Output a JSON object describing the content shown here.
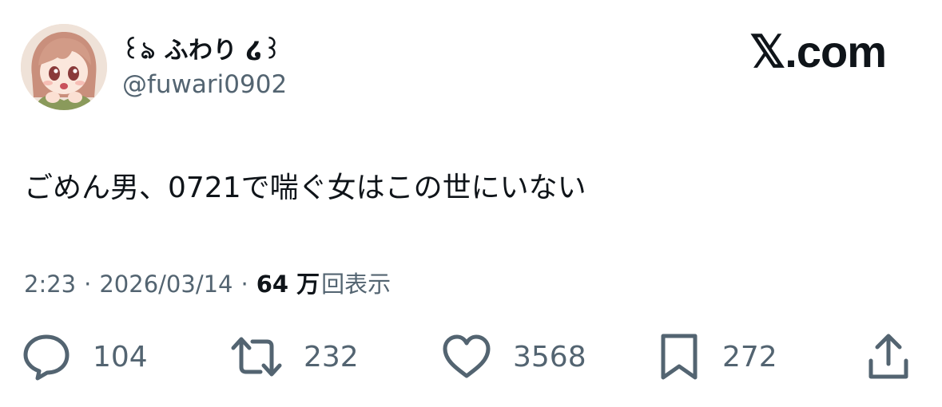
{
  "author": {
    "display_name": "꒰ঌ ふわり ໒꒱",
    "handle": "@fuwari0902",
    "avatar": "anime-girl-avatar"
  },
  "brand": {
    "label": "𝕏.com"
  },
  "tweet": {
    "text": "ごめん男、0721で喘ぐ女はこの世にいない"
  },
  "meta": {
    "time": "2:23",
    "separator": "·",
    "date": "2026/03/14",
    "views_count": "64 万",
    "views_label": "回表示"
  },
  "actions": {
    "reply": {
      "icon": "reply-icon",
      "count": "104"
    },
    "retweet": {
      "icon": "retweet-icon",
      "count": "232"
    },
    "like": {
      "icon": "heart-icon",
      "count": "3568"
    },
    "bookmark": {
      "icon": "bookmark-icon",
      "count": "272"
    },
    "share": {
      "icon": "share-icon"
    }
  },
  "colors": {
    "primary_text": "#0f1419",
    "secondary_text": "#536471",
    "background": "#ffffff"
  }
}
